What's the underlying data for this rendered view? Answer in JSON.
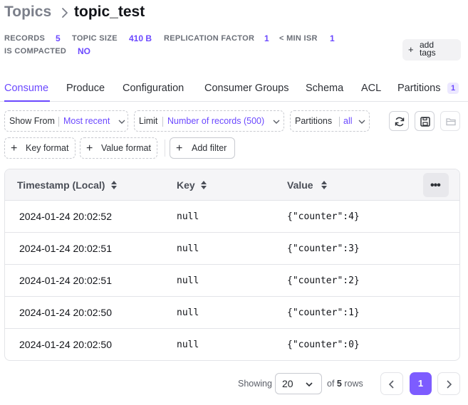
{
  "breadcrumb": {
    "root": "Topics",
    "current": "topic_test"
  },
  "stats": {
    "records_label": "RECORDS",
    "records_value": "5",
    "size_label": "TOPIC SIZE",
    "size_value": "410 B",
    "rf_label": "REPLICATION FACTOR",
    "rf_value": "1",
    "isr_label": "< MIN ISR",
    "isr_value": "1",
    "compacted_label": "IS COMPACTED",
    "compacted_value": "NO",
    "add_tags": "add tags"
  },
  "tabs": [
    {
      "label": "Consume",
      "active": true
    },
    {
      "label": "Produce"
    },
    {
      "label": "Configuration"
    },
    {
      "label": "Consumer Groups"
    },
    {
      "label": "Schema"
    },
    {
      "label": "ACL"
    },
    {
      "label": "Partitions",
      "badge": "1"
    }
  ],
  "filters": {
    "show_from_label": "Show From",
    "show_from_value": "Most recent",
    "limit_label": "Limit",
    "limit_value": "Number of records (500)",
    "partitions_label": "Partitions",
    "partitions_value": "all",
    "key_format": "Key format",
    "value_format": "Value format",
    "add_filter": "Add filter"
  },
  "table": {
    "columns": [
      "Timestamp (Local)",
      "Key",
      "Value"
    ],
    "rows": [
      {
        "timestamp": "2024-01-24 20:02:52",
        "key": "null",
        "value": "{\"counter\":4}"
      },
      {
        "timestamp": "2024-01-24 20:02:51",
        "key": "null",
        "value": "{\"counter\":3}"
      },
      {
        "timestamp": "2024-01-24 20:02:51",
        "key": "null",
        "value": "{\"counter\":2}"
      },
      {
        "timestamp": "2024-01-24 20:02:50",
        "key": "null",
        "value": "{\"counter\":1}"
      },
      {
        "timestamp": "2024-01-24 20:02:50",
        "key": "null",
        "value": "{\"counter\":0}"
      }
    ]
  },
  "pagination": {
    "showing": "Showing",
    "page_size": "20",
    "of": "of",
    "total": "5",
    "rows": "rows",
    "current_page": "1"
  },
  "colors": {
    "accent": "#6b48ff",
    "primary_button": "#7d5cff"
  },
  "icons": [
    "chevron-right-icon",
    "plus-icon",
    "chevron-down-icon",
    "refresh-icon",
    "save-icon",
    "folder-icon",
    "sort-icon",
    "more-icon",
    "chevron-left-icon"
  ]
}
